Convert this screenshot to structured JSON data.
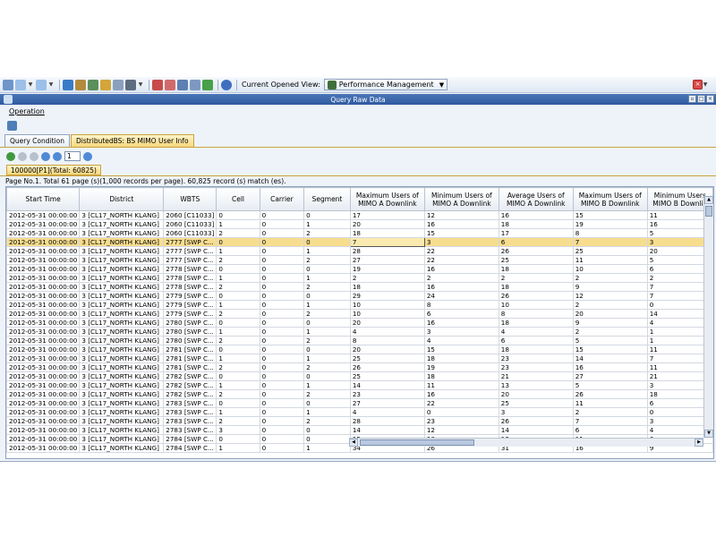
{
  "toolbar": {
    "view_label": "Current Opened View:",
    "view_value": "Performance Management"
  },
  "window": {
    "title": "Query Raw Data"
  },
  "menu": {
    "operation": "Operation"
  },
  "tabs": [
    {
      "label": "Query Condition"
    },
    {
      "label": "DistributedBS: BS MIMO User Info"
    }
  ],
  "nav": {
    "page_value": "1"
  },
  "subtab": {
    "label": "100000[P1](Total: 60825)"
  },
  "summary": "Page No.1. Total 61 page (s)(1,000 records per page). 60,825 record (s) match (es).",
  "table": {
    "columns": [
      "Start Time",
      "District",
      "WBTS",
      "Cell",
      "Carrier",
      "Segment",
      "Maximum Users of MIMO A Downlink",
      "Minimum Users of MIMO A Downlink",
      "Average Users of MIMO A Downlink",
      "Maximum Users of MIMO B Downlink",
      "Minimum Users MIMO B Downlin"
    ],
    "rows": [
      [
        "2012-05-31 00:00:00",
        "3 [CL17_NORTH KLANG]",
        "2060 [C11033]",
        "0",
        "0",
        "0",
        "17",
        "12",
        "16",
        "15",
        "11"
      ],
      [
        "2012-05-31 00:00:00",
        "3 [CL17_NORTH KLANG]",
        "2060 [C11033]",
        "1",
        "0",
        "1",
        "20",
        "16",
        "18",
        "19",
        "16"
      ],
      [
        "2012-05-31 00:00:00",
        "3 [CL17_NORTH KLANG]",
        "2060 [C11033]",
        "2",
        "0",
        "2",
        "18",
        "15",
        "17",
        "8",
        "5"
      ],
      [
        "2012-05-31 00:00:00",
        "3 [CL17_NORTH KLANG]",
        "2777 [SWP C...",
        "0",
        "0",
        "0",
        "7",
        "3",
        "6",
        "7",
        "3"
      ],
      [
        "2012-05-31 00:00:00",
        "3 [CL17_NORTH KLANG]",
        "2777 [SWP C...",
        "1",
        "0",
        "1",
        "28",
        "22",
        "26",
        "25",
        "20"
      ],
      [
        "2012-05-31 00:00:00",
        "3 [CL17_NORTH KLANG]",
        "2777 [SWP C...",
        "2",
        "0",
        "2",
        "27",
        "22",
        "25",
        "11",
        "5"
      ],
      [
        "2012-05-31 00:00:00",
        "3 [CL17_NORTH KLANG]",
        "2778 [SWP C...",
        "0",
        "0",
        "0",
        "19",
        "16",
        "18",
        "10",
        "6"
      ],
      [
        "2012-05-31 00:00:00",
        "3 [CL17_NORTH KLANG]",
        "2778 [SWP C...",
        "1",
        "0",
        "1",
        "2",
        "2",
        "2",
        "2",
        "2"
      ],
      [
        "2012-05-31 00:00:00",
        "3 [CL17_NORTH KLANG]",
        "2778 [SWP C...",
        "2",
        "0",
        "2",
        "18",
        "16",
        "18",
        "9",
        "7"
      ],
      [
        "2012-05-31 00:00:00",
        "3 [CL17_NORTH KLANG]",
        "2779 [SWP C...",
        "0",
        "0",
        "0",
        "29",
        "24",
        "26",
        "12",
        "7"
      ],
      [
        "2012-05-31 00:00:00",
        "3 [CL17_NORTH KLANG]",
        "2779 [SWP C...",
        "1",
        "0",
        "1",
        "10",
        "8",
        "10",
        "2",
        "0"
      ],
      [
        "2012-05-31 00:00:00",
        "3 [CL17_NORTH KLANG]",
        "2779 [SWP C...",
        "2",
        "0",
        "2",
        "10",
        "6",
        "8",
        "20",
        "14"
      ],
      [
        "2012-05-31 00:00:00",
        "3 [CL17_NORTH KLANG]",
        "2780 [SWP C...",
        "0",
        "0",
        "0",
        "20",
        "16",
        "18",
        "9",
        "4"
      ],
      [
        "2012-05-31 00:00:00",
        "3 [CL17_NORTH KLANG]",
        "2780 [SWP C...",
        "1",
        "0",
        "1",
        "4",
        "3",
        "4",
        "2",
        "1"
      ],
      [
        "2012-05-31 00:00:00",
        "3 [CL17_NORTH KLANG]",
        "2780 [SWP C...",
        "2",
        "0",
        "2",
        "8",
        "4",
        "6",
        "5",
        "1"
      ],
      [
        "2012-05-31 00:00:00",
        "3 [CL17_NORTH KLANG]",
        "2781 [SWP C...",
        "0",
        "0",
        "0",
        "20",
        "15",
        "18",
        "15",
        "11"
      ],
      [
        "2012-05-31 00:00:00",
        "3 [CL17_NORTH KLANG]",
        "2781 [SWP C...",
        "1",
        "0",
        "1",
        "25",
        "18",
        "23",
        "14",
        "7"
      ],
      [
        "2012-05-31 00:00:00",
        "3 [CL17_NORTH KLANG]",
        "2781 [SWP C...",
        "2",
        "0",
        "2",
        "26",
        "19",
        "23",
        "16",
        "11"
      ],
      [
        "2012-05-31 00:00:00",
        "3 [CL17_NORTH KLANG]",
        "2782 [SWP C...",
        "0",
        "0",
        "0",
        "25",
        "18",
        "21",
        "27",
        "21"
      ],
      [
        "2012-05-31 00:00:00",
        "3 [CL17_NORTH KLANG]",
        "2782 [SWP C...",
        "1",
        "0",
        "1",
        "14",
        "11",
        "13",
        "5",
        "3"
      ],
      [
        "2012-05-31 00:00:00",
        "3 [CL17_NORTH KLANG]",
        "2782 [SWP C...",
        "2",
        "0",
        "2",
        "23",
        "16",
        "20",
        "26",
        "18"
      ],
      [
        "2012-05-31 00:00:00",
        "3 [CL17_NORTH KLANG]",
        "2783 [SWP C...",
        "0",
        "0",
        "0",
        "27",
        "22",
        "25",
        "11",
        "6"
      ],
      [
        "2012-05-31 00:00:00",
        "3 [CL17_NORTH KLANG]",
        "2783 [SWP C...",
        "1",
        "0",
        "1",
        "4",
        "0",
        "3",
        "2",
        "0"
      ],
      [
        "2012-05-31 00:00:00",
        "3 [CL17_NORTH KLANG]",
        "2783 [SWP C...",
        "2",
        "0",
        "2",
        "28",
        "23",
        "26",
        "7",
        "3"
      ],
      [
        "2012-05-31 00:00:00",
        "3 [CL17_NORTH KLANG]",
        "2783 [SWP C...",
        "3",
        "0",
        "0",
        "14",
        "12",
        "14",
        "6",
        "4"
      ],
      [
        "2012-05-31 00:00:00",
        "3 [CL17_NORTH KLANG]",
        "2784 [SWP C...",
        "0",
        "0",
        "0",
        "15",
        "10",
        "13",
        "11",
        "6"
      ],
      [
        "2012-05-31 00:00:00",
        "3 [CL17_NORTH KLANG]",
        "2784 [SWP C...",
        "1",
        "0",
        "1",
        "34",
        "26",
        "31",
        "16",
        "9"
      ]
    ],
    "selected_row": 3
  },
  "colors": {
    "accent": "#2f5a9e",
    "selected_row": "#f7dd8e",
    "tab_active": "#f7d77c"
  }
}
